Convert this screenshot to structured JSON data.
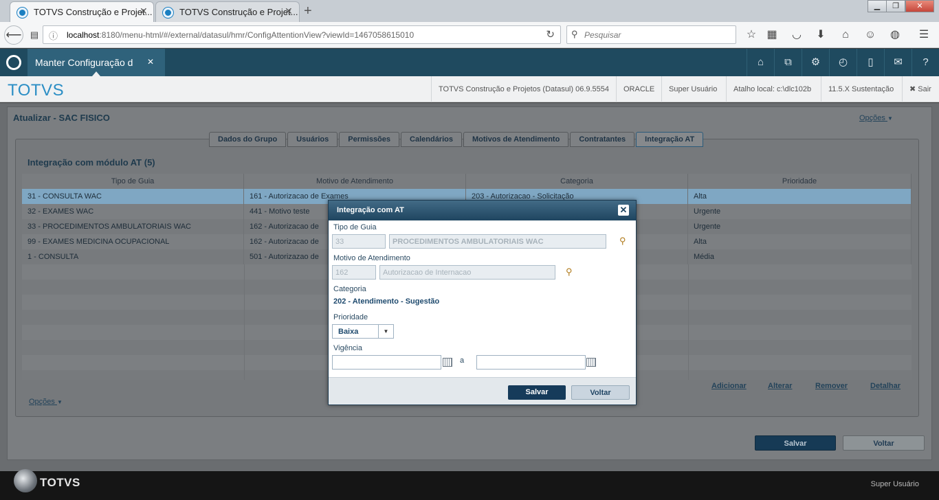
{
  "browser": {
    "tabs": [
      {
        "title": "TOTVS Construção e Projet..."
      },
      {
        "title": "TOTVS Construção e Projet..."
      }
    ],
    "url_host": "localhost",
    "url_rest": ":8180/menu-html/#/external/datasul/hmr/ConfigAttentionView?viewId=1467058615010",
    "search_placeholder": "Pesquisar"
  },
  "app": {
    "tab_title": "Manter Configuração d",
    "brand": "TOTVS",
    "info": {
      "product": "TOTVS Construção e Projetos (Datasul) 06.9.5554",
      "db": "ORACLE",
      "user": "Super Usuário",
      "shortcut": "Atalho local: c:\\dlc102b",
      "support": "11.5.X Sustentação",
      "logout": "Sair"
    }
  },
  "page": {
    "title": "Atualizar - SAC FISICO",
    "options_label": "Opções",
    "tabs": [
      "Dados do Grupo",
      "Usuários",
      "Permissões",
      "Calendários",
      "Motivos de Atendimento",
      "Contratantes",
      "Integração AT"
    ],
    "grid_title": "Integração com módulo AT",
    "grid_count": "(5)",
    "columns": [
      "Tipo de Guia",
      "Motivo de Atendimento",
      "Categoria",
      "Prioridade"
    ],
    "rows": [
      [
        "31 - CONSULTA WAC",
        "161 - Autorizacao de Exames",
        "203 - Autorizacao - Solicitação",
        "Alta"
      ],
      [
        "32 - EXAMES WAC",
        "441 - Motivo teste",
        "",
        "Urgente"
      ],
      [
        "33 - PROCEDIMENTOS AMBULATORIAIS WAC",
        "162 - Autorizacao de",
        "",
        "Urgente"
      ],
      [
        "99 - EXAMES MEDICINA OCUPACIONAL",
        "162 - Autorizacao de",
        "",
        "Alta"
      ],
      [
        "1 - CONSULTA",
        "501 - Autorizazao de",
        "",
        "Média"
      ]
    ],
    "grid_actions": [
      "Adicionar",
      "Alterar",
      "Remover",
      "Detalhar"
    ],
    "bottom_options": "Opções",
    "save_label": "Salvar",
    "back_label": "Voltar"
  },
  "modal": {
    "title": "Integração com AT",
    "tipo_label": "Tipo de Guia",
    "tipo_code": "33",
    "tipo_desc": "PROCEDIMENTOS AMBULATORIAIS WAC",
    "motivo_label": "Motivo de Atendimento",
    "motivo_code": "162",
    "motivo_desc": "Autorizacao de Internacao",
    "categoria_label": "Categoria",
    "categoria_value": "202 - Atendimento - Sugestão",
    "prioridade_label": "Prioridade",
    "prioridade_value": "Baixa",
    "vigencia_label": "Vigência",
    "vigencia_sep": "a",
    "vigencia_start": "",
    "vigencia_end": "",
    "save_label": "Salvar",
    "back_label": "Voltar"
  },
  "footer": {
    "brand": "TOTVS",
    "user": "Super Usuário"
  },
  "colors": {
    "header_bg": "#1f4a5f",
    "brand": "#2b8ec5",
    "selected_row": "#7fa7c3",
    "modal_header": "#1f4560"
  }
}
